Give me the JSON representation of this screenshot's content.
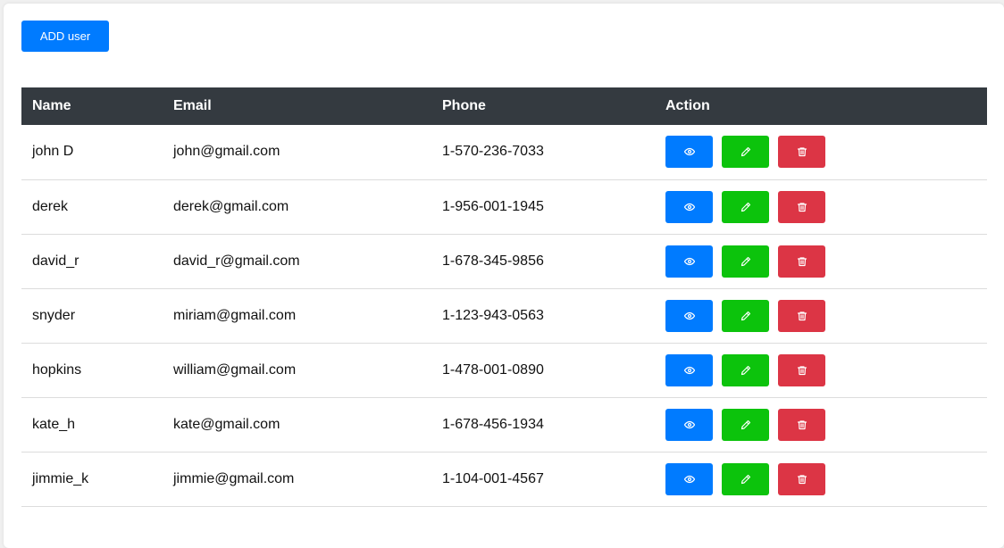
{
  "toolbar": {
    "add_label": "ADD user"
  },
  "table": {
    "columns": [
      "Name",
      "Email",
      "Phone",
      "Action"
    ],
    "rows": [
      {
        "name": "john D",
        "email": "john@gmail.com",
        "phone": "1-570-236-7033"
      },
      {
        "name": "derek",
        "email": "derek@gmail.com",
        "phone": "1-956-001-1945"
      },
      {
        "name": "david_r",
        "email": "david_r@gmail.com",
        "phone": "1-678-345-9856"
      },
      {
        "name": "snyder",
        "email": "miriam@gmail.com",
        "phone": "1-123-943-0563"
      },
      {
        "name": "hopkins",
        "email": "william@gmail.com",
        "phone": "1-478-001-0890"
      },
      {
        "name": "kate_h",
        "email": "kate@gmail.com",
        "phone": "1-678-456-1934"
      },
      {
        "name": "jimmie_k",
        "email": "jimmie@gmail.com",
        "phone": "1-104-001-4567"
      }
    ],
    "action_icons": [
      "eye-icon",
      "pencil-icon",
      "trash-icon"
    ]
  },
  "colors": {
    "primary": "#007bff",
    "success": "#0cc30c",
    "danger": "#dc3545",
    "header_bg": "#343a40"
  }
}
